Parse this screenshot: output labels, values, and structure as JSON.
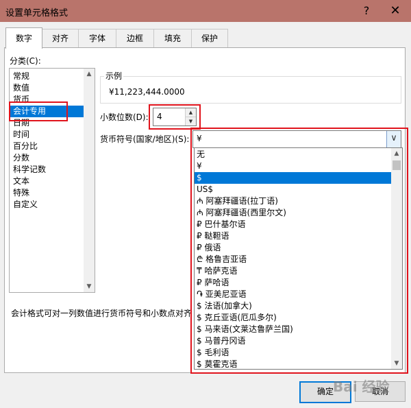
{
  "window": {
    "title": "设置单元格格式",
    "help": "?",
    "close": "✕"
  },
  "tabs": [
    "数字",
    "对齐",
    "字体",
    "边框",
    "填充",
    "保护"
  ],
  "category": {
    "label": "分类(C):",
    "items": [
      "常规",
      "数值",
      "货币",
      "会计专用",
      "日期",
      "时间",
      "百分比",
      "分数",
      "科学记数",
      "文本",
      "特殊",
      "自定义"
    ],
    "selected_index": 3
  },
  "sample": {
    "label": "示例",
    "value": "¥11,223,444.0000"
  },
  "decimal": {
    "label": "小数位数(D):",
    "value": "4",
    "up": "▲",
    "down": "▼"
  },
  "currency": {
    "label": "货币符号(国家/地区)(S):",
    "value": "¥",
    "dropdown_arrow": "∨",
    "options": [
      "无",
      "¥",
      "$",
      "US$",
      "₼ 阿塞拜疆语(拉丁语)",
      "₼ 阿塞拜疆语(西里尔文)",
      "₽ 巴什基尔语",
      "₽ 鞑靼语",
      "₽ 俄语",
      "₾ 格鲁吉亚语",
      "₸ 哈萨克语",
      "₽ 萨哈语",
      "֏ 亚美尼亚语",
      "$ 法语(加拿大)",
      "$ 克丘亚语(厄瓜多尔)",
      "$ 马来语(文莱达鲁萨兰国)",
      "$ 马普丹冈语",
      "$ 毛利语",
      "$ 莫霍克语"
    ],
    "selected_index": 2
  },
  "description": "会计格式可对一列数值进行货币符号和小数点对齐。",
  "buttons": {
    "ok": "确定",
    "cancel": "取消"
  },
  "watermark": "Bai 经验",
  "colors": {
    "titlebar": "#b9746b",
    "selection": "#0078d7",
    "highlight": "#e0131c"
  },
  "icons": {
    "scroll_up": "▲",
    "scroll_down": "▼"
  }
}
